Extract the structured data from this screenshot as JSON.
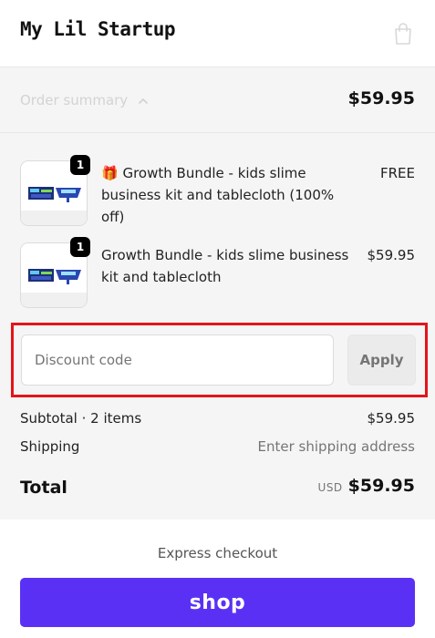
{
  "header": {
    "brand": "My Lil Startup",
    "cart_icon": "shopping-bag-icon"
  },
  "summary": {
    "label": "Order summary",
    "toggle_icon": "chevron-up-icon",
    "total": "$59.95"
  },
  "items": [
    {
      "quantity": "1",
      "gift_icon": "🎁",
      "name": "Growth Bundle - kids slime business kit and tablecloth (100% off)",
      "price": "FREE"
    },
    {
      "quantity": "1",
      "name": "Growth Bundle - kids slime business kit and tablecloth",
      "price": "$59.95"
    }
  ],
  "discount": {
    "placeholder": "Discount code",
    "apply_label": "Apply"
  },
  "totals": {
    "subtotal_label": "Subtotal · 2 items",
    "subtotal_value": "$59.95",
    "shipping_label": "Shipping",
    "shipping_value": "Enter shipping address",
    "total_label": "Total",
    "currency": "USD",
    "total_value": "$59.95"
  },
  "express": {
    "label": "Express checkout",
    "shop_label": "shop"
  },
  "colors": {
    "shop_purple": "#5a31f4",
    "highlight_red": "#e4141b",
    "panel_gray": "#f5f5f5"
  }
}
